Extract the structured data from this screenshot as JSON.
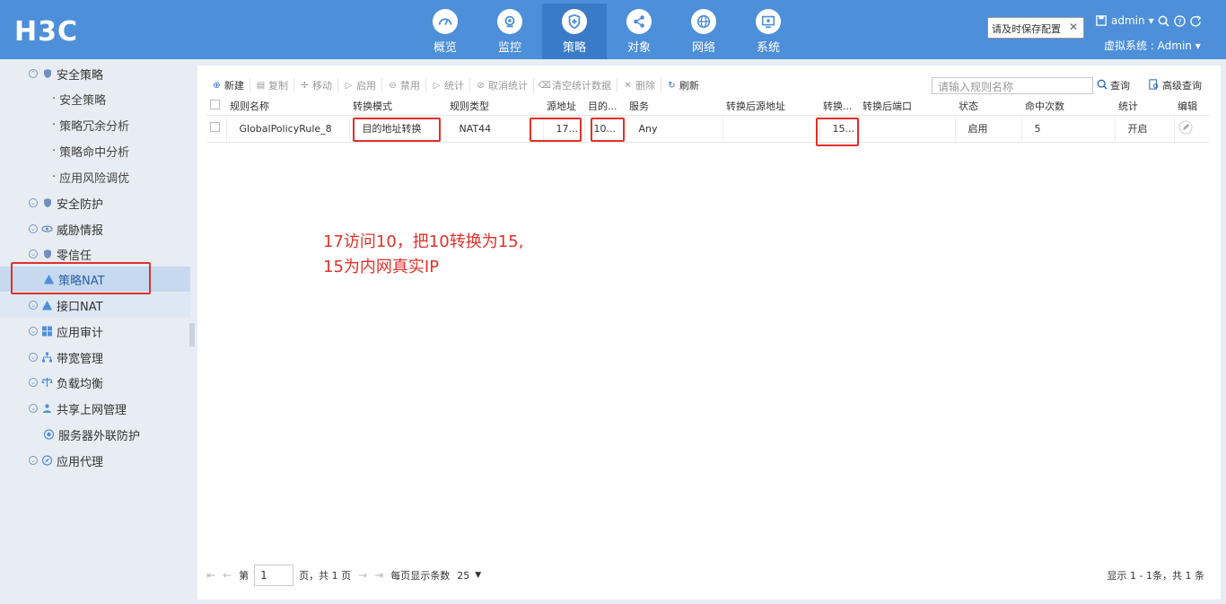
{
  "header": {
    "logo": "H3C",
    "nav": [
      {
        "label": "概览",
        "icon": "gauge-icon"
      },
      {
        "label": "监控",
        "icon": "camera-icon"
      },
      {
        "label": "策略",
        "icon": "shield-icon",
        "active": true
      },
      {
        "label": "对象",
        "icon": "share-icon"
      },
      {
        "label": "网络",
        "icon": "globe-icon"
      },
      {
        "label": "系统",
        "icon": "monitor-icon"
      }
    ],
    "save_tip": "请及时保存配置",
    "save_tip_close": "✕",
    "user": "admin",
    "vsys": "虚拟系统 : Admin"
  },
  "sidebar": {
    "items": [
      {
        "label": "安全策略",
        "type": "group"
      },
      {
        "label": "安全策略",
        "type": "sub"
      },
      {
        "label": "策略冗余分析",
        "type": "sub"
      },
      {
        "label": "策略命中分析",
        "type": "sub"
      },
      {
        "label": "应用风险调优",
        "type": "sub"
      },
      {
        "label": "安全防护",
        "type": "group"
      },
      {
        "label": "威胁情报",
        "type": "group"
      },
      {
        "label": "零信任",
        "type": "group"
      },
      {
        "label": "策略NAT",
        "type": "leaf"
      },
      {
        "label": "接口NAT",
        "type": "group"
      },
      {
        "label": "应用审计",
        "type": "group"
      },
      {
        "label": "带宽管理",
        "type": "group"
      },
      {
        "label": "负载均衡",
        "type": "group"
      },
      {
        "label": "共享上网管理",
        "type": "group"
      },
      {
        "label": "服务器外联防护",
        "type": "leaf"
      },
      {
        "label": "应用代理",
        "type": "group"
      }
    ]
  },
  "toolbar": {
    "new": "新建",
    "copy": "复制",
    "move": "移动",
    "enable": "启用",
    "disable": "禁用",
    "stats": "统计",
    "cancel_stats": "取消统计",
    "clear_stats": "清空统计数据",
    "delete": "删除",
    "refresh": "刷新",
    "search_placeholder": "请输入规则名称",
    "search": "查询",
    "advanced": "高级查询"
  },
  "table": {
    "columns": [
      "规则名称",
      "转换模式",
      "规则类型",
      "源地址",
      "目的...",
      "服务",
      "转换后源地址",
      "转换...",
      "转换后端口",
      "状态",
      "命中次数",
      "统计",
      "编辑"
    ],
    "rows": [
      {
        "name": "GlobalPolicyRule_8",
        "mode": "目的地址转换",
        "type": "NAT44",
        "src": "17...",
        "dst": "10...",
        "service": "Any",
        "trans_src": "",
        "trans_dst": "15...",
        "trans_port": "",
        "status": "启用",
        "hits": "5",
        "stats": "开启"
      }
    ]
  },
  "annotation": {
    "line1": "17访问10，把10转换为15,",
    "line2": "15为内网真实IP"
  },
  "pager": {
    "page_prefix": "第",
    "page": "1",
    "page_suffix": "页，共 1 页",
    "per_page_label": "每页显示条数",
    "per_page": "25",
    "summary": "显示 1 - 1条，共 1 条"
  }
}
